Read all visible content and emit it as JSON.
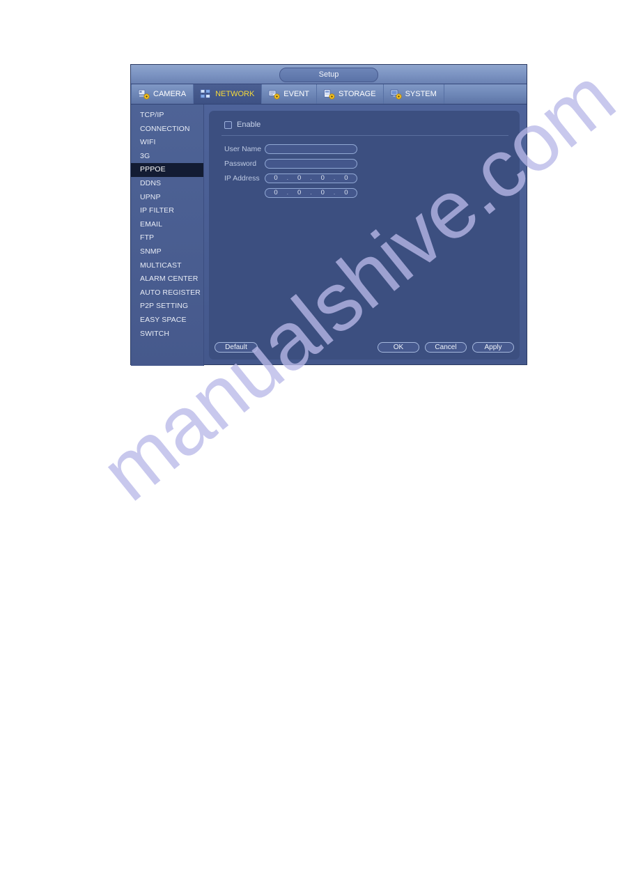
{
  "window": {
    "title": "Setup"
  },
  "tabs": [
    {
      "label": "CAMERA",
      "icon": "camera-gear-icon",
      "active": false
    },
    {
      "label": "NETWORK",
      "icon": "network-icon",
      "active": true
    },
    {
      "label": "EVENT",
      "icon": "event-gear-icon",
      "active": false
    },
    {
      "label": "STORAGE",
      "icon": "storage-gear-icon",
      "active": false
    },
    {
      "label": "SYSTEM",
      "icon": "system-gear-icon",
      "active": false
    }
  ],
  "sidebar": {
    "items": [
      {
        "label": "TCP/IP",
        "active": false
      },
      {
        "label": "CONNECTION",
        "active": false
      },
      {
        "label": "WIFI",
        "active": false
      },
      {
        "label": "3G",
        "active": false
      },
      {
        "label": "PPPOE",
        "active": true
      },
      {
        "label": "DDNS",
        "active": false
      },
      {
        "label": "UPNP",
        "active": false
      },
      {
        "label": "IP FILTER",
        "active": false
      },
      {
        "label": "EMAIL",
        "active": false
      },
      {
        "label": "FTP",
        "active": false
      },
      {
        "label": "SNMP",
        "active": false
      },
      {
        "label": "MULTICAST",
        "active": false
      },
      {
        "label": "ALARM CENTER",
        "active": false
      },
      {
        "label": "AUTO REGISTER",
        "active": false
      },
      {
        "label": "P2P SETTING",
        "active": false
      },
      {
        "label": "EASY SPACE",
        "active": false
      },
      {
        "label": "SWITCH",
        "active": false
      }
    ]
  },
  "form": {
    "enable_label": "Enable",
    "enable_checked": false,
    "username_label": "User Name",
    "username_value": "",
    "password_label": "Password",
    "password_value": "",
    "ip_label": "IP Address",
    "ip_rows": [
      [
        "0",
        "0",
        "0",
        "0"
      ],
      [
        "0",
        "0",
        "0",
        "0"
      ]
    ],
    "ip_separator": "."
  },
  "footer": {
    "default_label": "Default",
    "ok_label": "OK",
    "cancel_label": "Cancel",
    "apply_label": "Apply"
  },
  "watermark": {
    "text": "manualshive.com"
  },
  "colors": {
    "window_bg": "#4a5e93",
    "panel_bg": "#3c4f80",
    "sidebar_bg": "#4a5e92",
    "active_item_bg": "#131c33",
    "active_tab_text": "#f5d93a",
    "text": "#e8ecf6",
    "label_text": "#bdc9e2",
    "input_border": "#91a8d4",
    "watermark": "#b9b9e8"
  }
}
